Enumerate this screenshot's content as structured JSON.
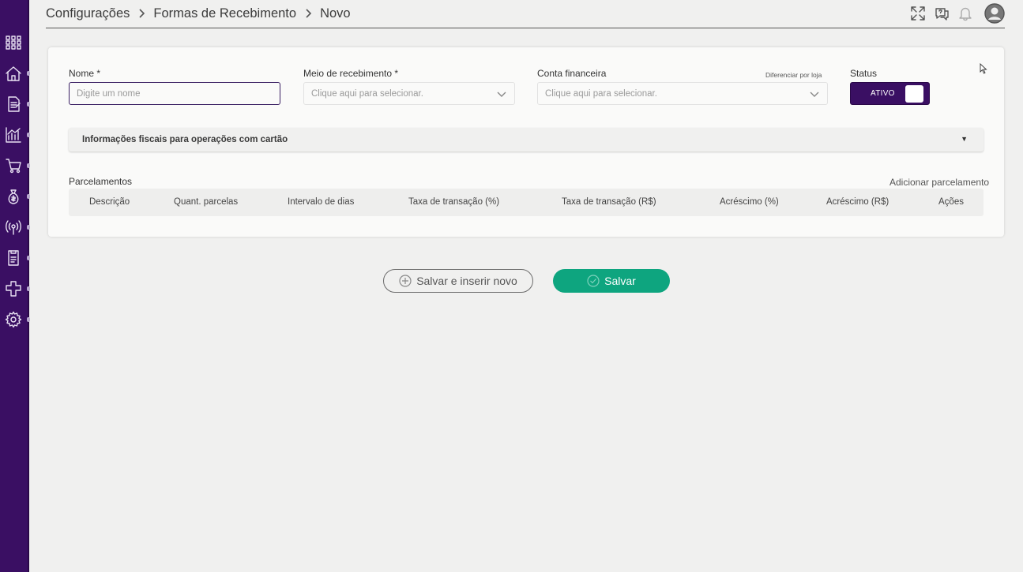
{
  "sidebar": {
    "icons": [
      "apps-grid-icon",
      "home-icon",
      "document-icon",
      "chart-icon",
      "cart-icon",
      "money-bag-icon",
      "broadcast-icon",
      "receipt-icon",
      "puzzle-icon",
      "settings-gear-icon"
    ]
  },
  "breadcrumb": {
    "items": [
      "Configurações",
      "Formas de Recebimento",
      "Novo"
    ]
  },
  "header": {
    "icons": [
      "expand-icon",
      "chat-help-icon",
      "bell-icon",
      "user-avatar-icon"
    ]
  },
  "form": {
    "nome": {
      "label": "Nome *",
      "placeholder": "Digite um nome"
    },
    "meio": {
      "label": "Meio de recebimento *",
      "placeholder": "Clique aqui para selecionar."
    },
    "conta": {
      "label": "Conta financeira",
      "placeholder": "Clique aqui para selecionar.",
      "link": "Diferenciar por loja"
    },
    "status": {
      "label": "Status",
      "value": "ATIVO"
    }
  },
  "accordion": {
    "title": "Informações fiscais para operações com cartão",
    "caret": "▼"
  },
  "parcelamentos": {
    "title": "Parcelamentos",
    "add_link": "Adicionar parcelamento",
    "columns": [
      "Descrição",
      "Quant. parcelas",
      "Intervalo de dias",
      "Taxa de transação (%)",
      "Taxa de transação (R$)",
      "Acréscimo (%)",
      "Acréscimo (R$)",
      "Ações"
    ]
  },
  "actions": {
    "save_new": "Salvar e inserir novo",
    "save": "Salvar"
  },
  "colors": {
    "sidebar": "#3a0f63",
    "primary_button": "#0ea57f",
    "toggle": "#3a0f63"
  }
}
